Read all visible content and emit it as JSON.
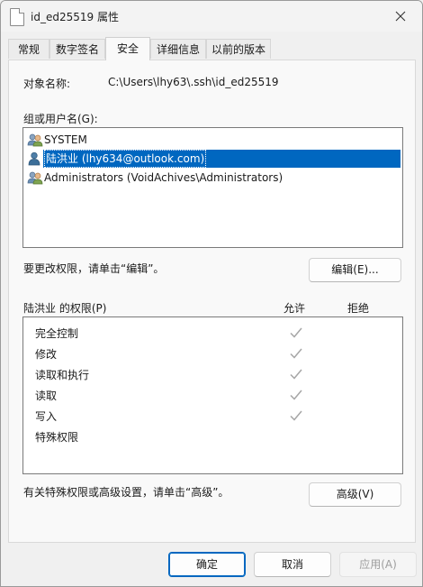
{
  "window": {
    "title": "id_ed25519 属性"
  },
  "tabs": [
    {
      "label": "常规"
    },
    {
      "label": "数字签名"
    },
    {
      "label": "安全"
    },
    {
      "label": "详细信息"
    },
    {
      "label": "以前的版本"
    }
  ],
  "security": {
    "object_name_label": "对象名称:",
    "object_name_value": "C:\\Users\\lhy63\\.ssh\\id_ed25519",
    "groups_label": "组或用户名(G):",
    "users": [
      {
        "name": "SYSTEM",
        "icon": "users-group-icon"
      },
      {
        "name": "陆洪业 (lhy634@outlook.com)",
        "icon": "user-icon",
        "selected": true
      },
      {
        "name": "Administrators (VoidAchives\\Administrators)",
        "icon": "users-group-icon"
      }
    ],
    "edit_hint": "要更改权限，请单击“编辑”。",
    "edit_button": "编辑(E)...",
    "perm_title": "陆洪业 的权限(P)",
    "allow_header": "允许",
    "deny_header": "拒绝",
    "permissions": [
      {
        "name": "完全控制",
        "allow": true,
        "deny": false
      },
      {
        "name": "修改",
        "allow": true,
        "deny": false
      },
      {
        "name": "读取和执行",
        "allow": true,
        "deny": false
      },
      {
        "name": "读取",
        "allow": true,
        "deny": false
      },
      {
        "name": "写入",
        "allow": true,
        "deny": false
      },
      {
        "name": "特殊权限",
        "allow": false,
        "deny": false
      }
    ],
    "advanced_hint": "有关特殊权限或高级设置，请单击“高级”。",
    "advanced_button": "高级(V)"
  },
  "footer": {
    "ok": "确定",
    "cancel": "取消",
    "apply": "应用(A)"
  },
  "colors": {
    "accent": "#0067c0",
    "check": "#a6a6a6"
  }
}
